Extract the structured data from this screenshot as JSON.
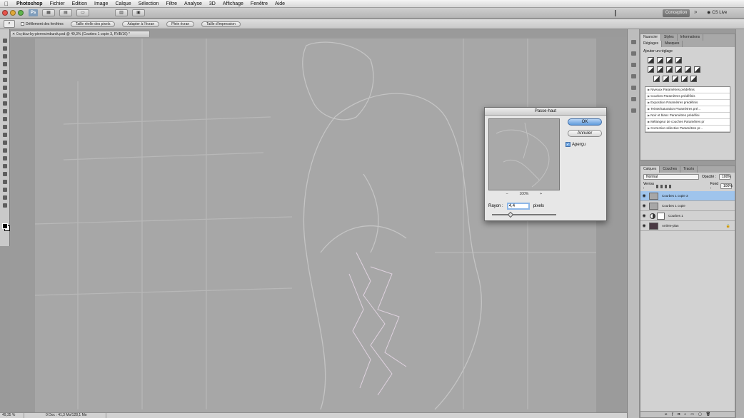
{
  "menubar": {
    "apple": "",
    "items": [
      "Photoshop",
      "Fichier",
      "Edition",
      "Image",
      "Calque",
      "Sélection",
      "Filtre",
      "Analyse",
      "3D",
      "Affichage",
      "Fenêtre",
      "Aide"
    ]
  },
  "appbar": {
    "ps_label": "Ps",
    "workspace": "Conception",
    "chevron": "»",
    "cslive": "CS Live"
  },
  "options": {
    "checkbox_label": "Défilement des fenêtres",
    "buttons": [
      "Taille réelle des pixels",
      "Adapter à l'écran",
      "Plein écran",
      "Taille d'impression"
    ]
  },
  "document": {
    "tab_title": "0.q-bizz-by-pierrecimbursk.psd @ 49,3% (Courbes 1 copie 3, RVB/16) *",
    "close": "✕"
  },
  "status": {
    "zoom": "49,35 %",
    "info": "0 Doc : 41,3 Mo/128,1 Mo"
  },
  "panels": {
    "top_tabs": [
      "Nuancier",
      "Styles",
      "Informations"
    ],
    "adj_tabs": [
      "Réglages",
      "Masques"
    ],
    "adj_title": "Ajouter un réglage",
    "presets": [
      "Niveaux Paramètres prédéfinis",
      "Courbes Paramètres prédéfinis",
      "Exposition Paramètres prédéfinis",
      "Teinte/Saturation Paramètres pré...",
      "Noir et blanc Paramètres prédéfini",
      "Mélangeur de couches Paramètres pr",
      "Correction sélective Paramètres pr..."
    ],
    "layer_tabs": [
      "Calques",
      "Couches",
      "Tracés"
    ],
    "blend_mode": "Normal",
    "opacity_label": "Opacité :",
    "opacity_value": "100%",
    "lock_label": "Verrou :",
    "fill_label": "Fond :",
    "fill_value": "100%",
    "layers": [
      {
        "name": "Courbes 1 copie 3",
        "selected": true
      },
      {
        "name": "Courbes 1 copie",
        "selected": false
      },
      {
        "name": "Courbes 1",
        "selected": false
      },
      {
        "name": "Arrière-plan",
        "selected": false
      }
    ]
  },
  "dialog": {
    "title": "Passe-haut",
    "ok": "OK",
    "cancel": "Annuler",
    "preview_label": "Aperçu",
    "zoom_minus": "–",
    "zoom_value": "100%",
    "zoom_plus": "+",
    "radius_label": "Rayon :",
    "radius_value": "4,4",
    "radius_unit": "pixels",
    "radius_slider_fraction": 0.25
  },
  "colors": {
    "accent": "#6ea6e3",
    "selected_layer": "#9fc4ec"
  }
}
